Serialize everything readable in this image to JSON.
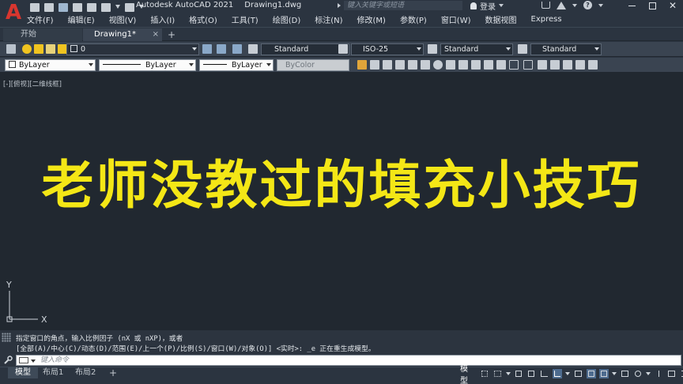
{
  "app": {
    "logo_letter": "A",
    "title": "Autodesk AutoCAD 2021",
    "filename": "Drawing1.dwg"
  },
  "search": {
    "placeholder": "键入关键字或短语"
  },
  "account": {
    "login_label": "登录"
  },
  "menu": [
    "文件(F)",
    "编辑(E)",
    "视图(V)",
    "插入(I)",
    "格式(O)",
    "工具(T)",
    "绘图(D)",
    "标注(N)",
    "修改(M)",
    "参数(P)",
    "窗口(W)",
    "数据视图",
    "Express"
  ],
  "tabs": {
    "start": "开始",
    "drawing": "Drawing1*",
    "close": "×",
    "add": "+"
  },
  "toolbar1": {
    "layer_value": "0",
    "text_style": "Standard",
    "dim_style": "ISO-25",
    "table_style": "Standard",
    "mleader_style": "Standard"
  },
  "toolbar2": {
    "color": "ByLayer",
    "linetype": "ByLayer",
    "lineweight": "ByLayer",
    "plotstyle": "ByColor"
  },
  "canvas": {
    "view_label": "[-][俯视][二维线框]",
    "banner": "老师没教过的填充小技巧",
    "ucs_y": "Y",
    "ucs_x": "X"
  },
  "command": {
    "history_1": "指定窗口的角点，输入比例因子 (nX 或 nXP)，或者",
    "history_2": "[全部(A)/中心(C)/动态(D)/范围(E)/上一个(P)/比例(S)/窗口(W)/对象(O)] <实时>: _e 正在重生成模型。",
    "placeholder": "键入命令"
  },
  "layouts": {
    "model": "模型",
    "layout1": "布局1",
    "layout2": "布局2",
    "add": "+"
  },
  "status": {
    "model_label": "模型"
  },
  "colors": {
    "banner": "#f4e716",
    "canvas": "#212830",
    "logo": "#d8362f",
    "accent": "#4d6b8e"
  }
}
